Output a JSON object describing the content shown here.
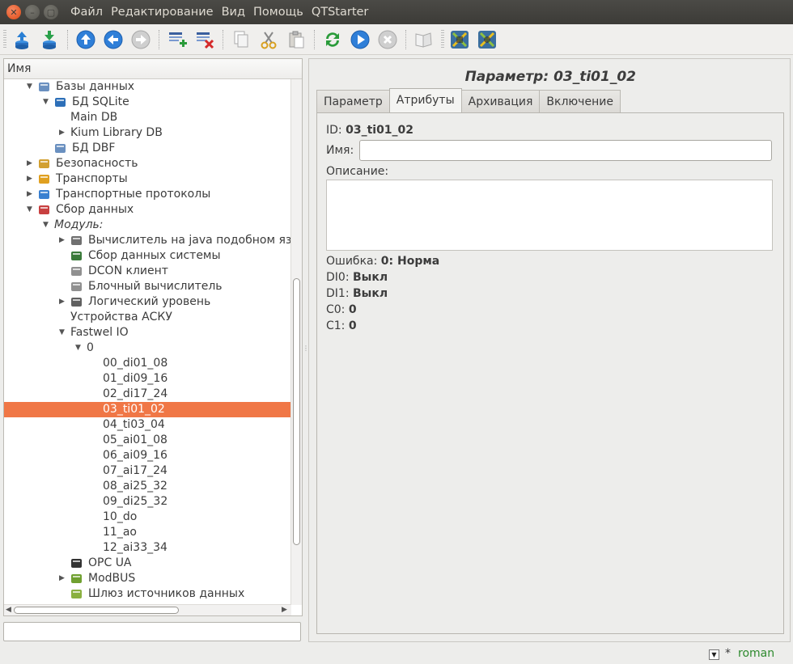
{
  "titlebar": {
    "menu": [
      "Файл",
      "Редактирование",
      "Вид",
      "Помощь",
      "QTStarter"
    ]
  },
  "toolbar": {
    "buttons": [
      {
        "name": "db-load-icon",
        "color": "#2a7fd4"
      },
      {
        "name": "db-save-icon",
        "color": "#2aa04a"
      },
      {
        "name": "up-icon",
        "color": "#2f7fd8"
      },
      {
        "name": "back-icon",
        "color": "#2f7fd8"
      },
      {
        "name": "forward-icon",
        "color": "#a8a8a8"
      },
      {
        "name": "add-item-icon",
        "color": "#2a9b3a"
      },
      {
        "name": "delete-item-icon",
        "color": "#d42a2a"
      },
      {
        "name": "copy-icon",
        "color": "#b8b8b8"
      },
      {
        "name": "cut-icon",
        "color": "#d8a020"
      },
      {
        "name": "paste-icon",
        "color": "#b8b8b8"
      },
      {
        "name": "refresh-icon",
        "color": "#2a9b3a"
      },
      {
        "name": "start-icon",
        "color": "#2f7fd8"
      },
      {
        "name": "stop-icon",
        "color": "#a8a8a8"
      },
      {
        "name": "manual-icon",
        "color": "#c8c8c8"
      },
      {
        "name": "tools-icon-1",
        "color": "#3a6e9e"
      },
      {
        "name": "tools-icon-2",
        "color": "#3a6e9e"
      }
    ]
  },
  "tree": {
    "header": "Имя",
    "items": [
      {
        "label": "Базы данных",
        "indent": 0,
        "arrow": "down",
        "icon": "databases-icon"
      },
      {
        "label": "БД SQLite",
        "indent": 1,
        "arrow": "down",
        "icon": "sqlite-icon"
      },
      {
        "label": "Main DB",
        "indent": 2,
        "arrow": "",
        "icon": ""
      },
      {
        "label": "Kium Library DB",
        "indent": 2,
        "arrow": "right",
        "icon": ""
      },
      {
        "label": "БД DBF",
        "indent": 1,
        "arrow": "",
        "icon": "dbf-icon"
      },
      {
        "label": "Безопасность",
        "indent": 0,
        "arrow": "right",
        "icon": "security-icon"
      },
      {
        "label": "Транспорты",
        "indent": 0,
        "arrow": "right",
        "icon": "transports-icon"
      },
      {
        "label": "Транспортные протоколы",
        "indent": 0,
        "arrow": "right",
        "icon": "protocols-icon"
      },
      {
        "label": "Сбор данных",
        "indent": 0,
        "arrow": "down",
        "icon": "data-acquisition-icon"
      },
      {
        "label": "Модуль:",
        "indent": 1,
        "arrow": "down",
        "icon": "",
        "italic": true
      },
      {
        "label": "Вычислитель на java подобном языке",
        "indent": 2,
        "arrow": "right",
        "icon": "calculator-icon"
      },
      {
        "label": "Сбор данных системы",
        "indent": 2,
        "arrow": "",
        "icon": "system-icon"
      },
      {
        "label": "DCON клиент",
        "indent": 2,
        "arrow": "",
        "icon": "dcon-icon"
      },
      {
        "label": "Блочный вычислитель",
        "indent": 2,
        "arrow": "",
        "icon": "block-icon"
      },
      {
        "label": "Логический уровень",
        "indent": 2,
        "arrow": "right",
        "icon": "logic-icon"
      },
      {
        "label": "Устройства АСКУ",
        "indent": 2,
        "arrow": "",
        "icon": ""
      },
      {
        "label": "Fastwel IO",
        "indent": 2,
        "arrow": "down",
        "icon": "",
        "noIconPad": true
      },
      {
        "label": "0",
        "indent": 3,
        "arrow": "down",
        "icon": ""
      },
      {
        "label": "00_di01_08",
        "indent": 4,
        "arrow": "",
        "icon": ""
      },
      {
        "label": "01_di09_16",
        "indent": 4,
        "arrow": "",
        "icon": ""
      },
      {
        "label": "02_di17_24",
        "indent": 4,
        "arrow": "",
        "icon": ""
      },
      {
        "label": "03_ti01_02",
        "indent": 4,
        "arrow": "",
        "icon": "",
        "selected": true
      },
      {
        "label": "04_ti03_04",
        "indent": 4,
        "arrow": "",
        "icon": ""
      },
      {
        "label": "05_ai01_08",
        "indent": 4,
        "arrow": "",
        "icon": ""
      },
      {
        "label": "06_ai09_16",
        "indent": 4,
        "arrow": "",
        "icon": ""
      },
      {
        "label": "07_ai17_24",
        "indent": 4,
        "arrow": "",
        "icon": ""
      },
      {
        "label": "08_ai25_32",
        "indent": 4,
        "arrow": "",
        "icon": ""
      },
      {
        "label": "09_di25_32",
        "indent": 4,
        "arrow": "",
        "icon": ""
      },
      {
        "label": "10_do",
        "indent": 4,
        "arrow": "",
        "icon": ""
      },
      {
        "label": "11_ao",
        "indent": 4,
        "arrow": "",
        "icon": ""
      },
      {
        "label": "12_ai33_34",
        "indent": 4,
        "arrow": "",
        "icon": ""
      },
      {
        "label": "OPC UA",
        "indent": 2,
        "arrow": "",
        "icon": "opcua-icon"
      },
      {
        "label": "ModBUS",
        "indent": 2,
        "arrow": "right",
        "icon": "modbus-icon"
      },
      {
        "label": "Шлюз источников данных",
        "indent": 2,
        "arrow": "",
        "icon": "gateway-icon"
      }
    ]
  },
  "panel": {
    "title": "Параметр: 03_ti01_02",
    "tabs": [
      "Параметр",
      "Атрибуты",
      "Архивация",
      "Включение"
    ],
    "active_tab": "Атрибуты",
    "id_label": "ID:",
    "id_value": "03_ti01_02",
    "name_label": "Имя:",
    "name_value": "",
    "description_label": "Описание:",
    "description_value": "",
    "error_label": "Ошибка:",
    "error_value": "0: Норма",
    "di0_label": "DI0:",
    "di0_value": "Выкл",
    "di1_label": "DI1:",
    "di1_value": "Выкл",
    "c0_label": "C0:",
    "c0_value": "0",
    "c1_label": "C1:",
    "c1_value": "0"
  },
  "status": {
    "modified": "*",
    "user": "roman",
    "user_color": "#2e8a2e"
  },
  "colors": {
    "selection": "#f07746",
    "accent": "#dd4814"
  }
}
